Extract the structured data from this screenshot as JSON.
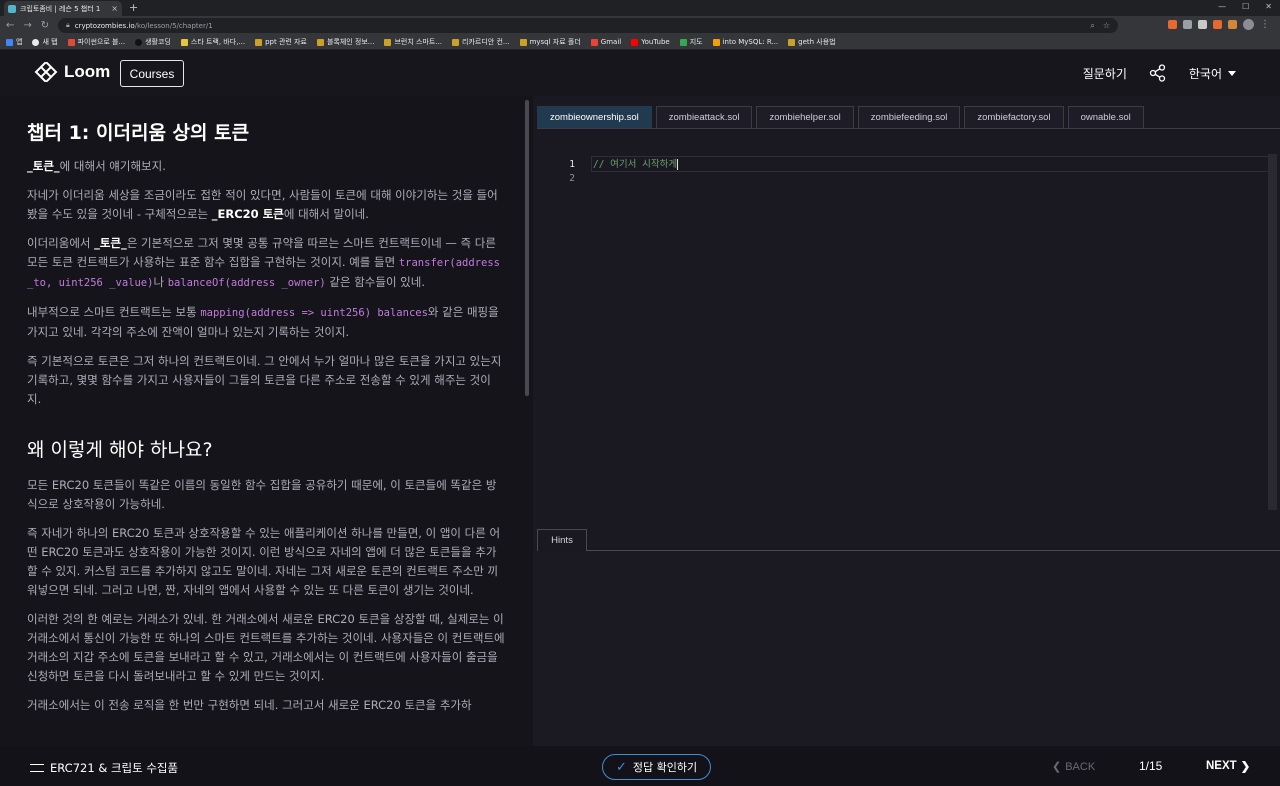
{
  "browser": {
    "tab_title": "크립토좀비 | 레슨 5 챕터 1",
    "url_host": "cryptozombies.io",
    "url_path": "/ko/lesson/5/chapter/1",
    "bookmarks": [
      "앱",
      "새 탭",
      "파이썬으로 블...",
      "생활코딩",
      "스타 트랙, 바다,...",
      "ppt 관련 자료",
      "블록체인 정보...",
      "브런치 스마트...",
      "리카르디안 컨...",
      "mysql 자료 폴더",
      "Gmail",
      "YouTube",
      "지도",
      "into MySQL: R...",
      "geth 사용법"
    ]
  },
  "header": {
    "logo": "Loom",
    "courses": "Courses",
    "ask": "질문하기",
    "language": "한국어"
  },
  "lesson": {
    "title": "챕터 1: 이더리움 상의 토큰",
    "p1a": "_토큰_",
    "p1b": "에 대해서 얘기해보지.",
    "p2a": "자네가 이더리움 세상을 조금이라도 접한 적이 있다면, 사람들이 토큰에 대해 이야기하는 것을 들어봤을 수도 있을 것이네 - 구체적으로는 ",
    "p2b": "_ERC20 토큰",
    "p2c": "에 대해서 말이네.",
    "p3a": "이더리움에서 ",
    "p3b": "_토큰_",
    "p3c": "은 기본적으로 그저 몇몇 공통 규약을 따르는 스마트 컨트랙트이네 — 즉 다른 모든 토큰 컨트랙트가 사용하는 표준 함수 집합을 구현하는 것이지. 예를 들면 ",
    "p3d": "transfer(address _to, uint256 _value)",
    "p3e": "나 ",
    "p3f": "balanceOf(address _owner)",
    "p3g": " 같은 함수들이 있네.",
    "p4a": "내부적으로 스마트 컨트랙트는 보통 ",
    "p4b": "mapping(address => uint256) balances",
    "p4c": "와 같은 매핑을 가지고 있네. 각각의 주소에 잔액이 얼마나 있는지 기록하는 것이지.",
    "p5": "즉 기본적으로 토큰은 그저 하나의 컨트랙트이네. 그 안에서 누가 얼마나 많은 토큰을 가지고 있는지 기록하고, 몇몇 함수를 가지고 사용자들이 그들의 토큰을 다른 주소로 전송할 수 있게 해주는 것이지.",
    "h2": "왜 이렇게 해야 하나요?",
    "p6": "모든 ERC20 토큰들이 똑같은 이름의 동일한 함수 집합을 공유하기 때문에, 이 토큰들에 똑같은 방식으로 상호작용이 가능하네.",
    "p7": "즉 자네가 하나의 ERC20 토큰과 상호작용할 수 있는 애플리케이션 하나를 만들면, 이 앱이 다른 어떤 ERC20 토큰과도 상호작용이 가능한 것이지. 이런 방식으로 자네의 앱에 더 많은 토큰들을 추가할 수 있지. 커스텀 코드를 추가하지 않고도 말이네. 자네는 그저 새로운 토큰의 컨트랙트 주소만 끼워넣으면 되네. 그러고 나면, 짠, 자네의 앱에서 사용할 수 있는 또 다른 토큰이 생기는 것이네.",
    "p8": "이러한 것의 한 예로는 거래소가 있네. 한 거래소에서 새로운 ERC20 토큰을 상장할 때, 실제로는 이 거래소에서 통신이 가능한 또 하나의 스마트 컨트랙트를 추가하는 것이네. 사용자들은 이 컨트랙트에 거래소의 지갑 주소에 토큰을 보내라고 할 수 있고, 거래소에서는 이 컨트랙트에 사용자들이 출금을 신청하면 토큰을 다시 돌려보내라고 할 수 있게 만드는 것이지.",
    "p9": "거래소에서는 이 전송 로직을 한 번만 구현하면 되네. 그러고서 새로운 ERC20 토큰을 추가하"
  },
  "editor": {
    "tabs": [
      "zombieownership.sol",
      "zombieattack.sol",
      "zombiehelper.sol",
      "zombiefeeding.sol",
      "zombiefactory.sol",
      "ownable.sol"
    ],
    "line_numbers": [
      "1",
      "2"
    ],
    "code_line1": "// 여기서 시작하게",
    "hints_tab": "Hints"
  },
  "footer": {
    "crumb": "ERC721 & 크립토 수집품",
    "check": "정답 확인하기",
    "back": "BACK",
    "pager": "1/15",
    "next": "NEXT"
  }
}
